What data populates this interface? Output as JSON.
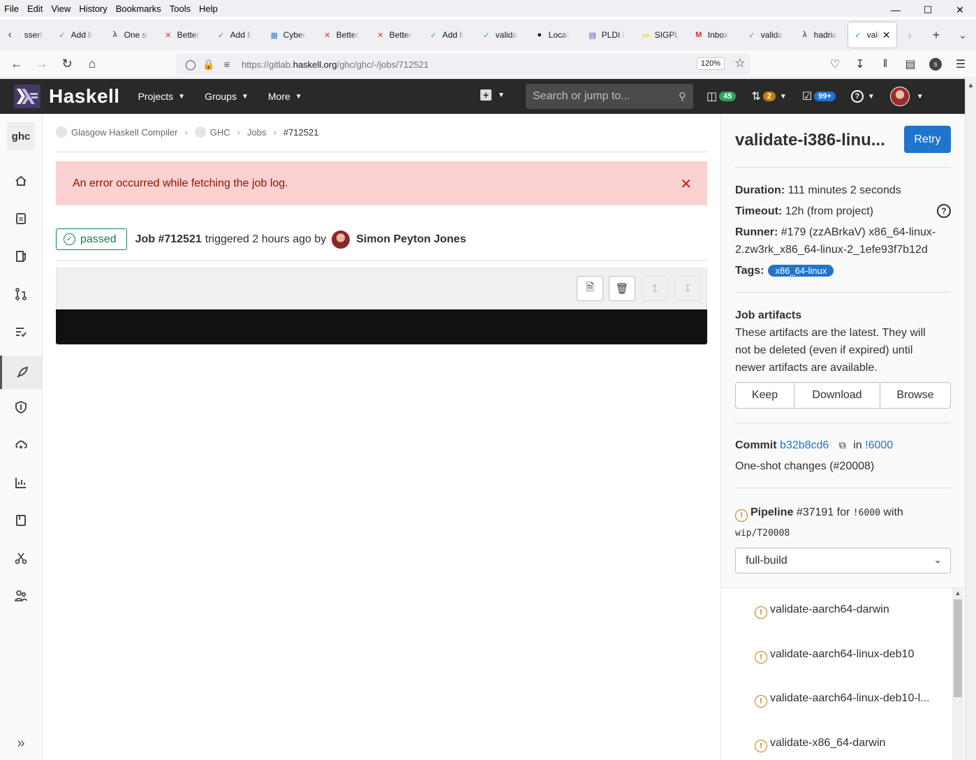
{
  "browser": {
    "menu": [
      "File",
      "Edit",
      "View",
      "History",
      "Bookmarks",
      "Tools",
      "Help"
    ],
    "tabs": [
      {
        "label": "ssert",
        "icon": ""
      },
      {
        "label": "Add li",
        "icon": "check"
      },
      {
        "label": "One sl",
        "icon": "haskell"
      },
      {
        "label": "Better",
        "icon": "x"
      },
      {
        "label": "Add li",
        "icon": "check"
      },
      {
        "label": "Cyber",
        "icon": "grid"
      },
      {
        "label": "Better",
        "icon": "x"
      },
      {
        "label": "Better",
        "icon": "x"
      },
      {
        "label": "Add li",
        "icon": "check"
      },
      {
        "label": "valida",
        "icon": "check"
      },
      {
        "label": "Local",
        "icon": "github"
      },
      {
        "label": "PLDI I",
        "icon": "doc"
      },
      {
        "label": "SIGPL",
        "icon": "slides"
      },
      {
        "label": "Inbox",
        "icon": "gmail"
      },
      {
        "label": "valida",
        "icon": "check"
      },
      {
        "label": "hadria",
        "icon": "haskell"
      }
    ],
    "active_tab": {
      "label": "vali"
    },
    "url_prefix": "https://gitlab.",
    "url_host": "haskell.org",
    "url_path": "/ghc/ghc/-/jobs/712521",
    "zoom": "120%"
  },
  "header": {
    "brand": "Haskell",
    "menu": [
      "Projects",
      "Groups",
      "More"
    ],
    "search_placeholder": "Search or jump to...",
    "issues_count": "45",
    "mr_count": "2",
    "todo_count": "99+"
  },
  "sidebar": {
    "project_avatar": "ghc",
    "items": [
      "home-icon",
      "issues-icon",
      "issues-board-icon",
      "merge-requests-icon",
      "tasks-icon",
      "rocket-icon",
      "shield-icon",
      "deployments-icon",
      "analytics-icon",
      "wiki-icon",
      "snippets-icon",
      "members-icon"
    ]
  },
  "breadcrumb": [
    "Glasgow Haskell Compiler",
    "GHC",
    "Jobs",
    "#712521"
  ],
  "alert": {
    "message": "An error occurred while fetching the job log."
  },
  "job": {
    "status": "passed",
    "id_label": "Job #712521",
    "triggered": "triggered 2 hours ago by",
    "user": "Simon Peyton Jones"
  },
  "right": {
    "title": "validate-i386-linu...",
    "retry": "Retry",
    "duration_label": "Duration:",
    "duration": "111 minutes 2 seconds",
    "timeout_label": "Timeout:",
    "timeout": "12h (from project)",
    "runner_label": "Runner:",
    "runner_line1": "#179 (zzABrkaV) x86_64-linux-",
    "runner_line2": "2.zw3rk_x86_64-linux-2_1efe93f7b12d",
    "tags_label": "Tags:",
    "tag": "x86_64-linux",
    "artifacts_title": "Job artifacts",
    "artifacts_line1": "These artifacts are the latest. They will",
    "artifacts_line2": "not be deleted (even if expired) until",
    "artifacts_line3": "newer artifacts are available.",
    "keep": "Keep",
    "download": "Download",
    "browse": "Browse",
    "commit_label": "Commit",
    "commit_sha": "b32b8cd6",
    "commit_in": "in",
    "commit_mr": "!6000",
    "commit_msg": "One-shot changes (#20008)",
    "pipeline_label": "Pipeline",
    "pipeline_id": "#37191 for",
    "pipeline_ref": "!6000",
    "pipeline_with": "with",
    "pipeline_branch": "wip/T20008",
    "stage": "full-build",
    "jobs": [
      "validate-aarch64-darwin",
      "validate-aarch64-linux-deb10",
      "validate-aarch64-linux-deb10-l...",
      "validate-x86_64-darwin"
    ]
  },
  "colors": {
    "header_bg": "#292929",
    "primary": "#1f75cb",
    "alert_bg": "#fcd1d1",
    "success": "#108548",
    "warning": "#c17d10"
  }
}
